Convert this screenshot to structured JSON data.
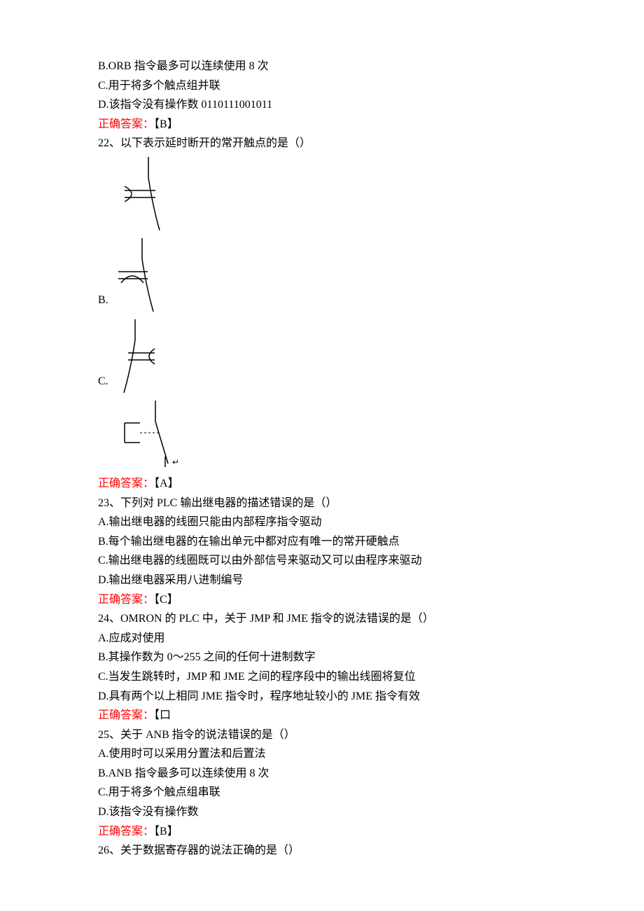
{
  "q21_remainder": {
    "optB": "B.ORB 指令最多可以连续使用 8 次",
    "optC": "C.用于将多个触点组并联",
    "optD": "D.该指令没有操作数 0110111001011",
    "answer_label": "正确答案：",
    "answer_value": "【B】"
  },
  "q22": {
    "stem": "22、以下表示延时断开的常开触点的是（）",
    "optB_label": "B.",
    "optC_label": "C.",
    "answer_label": "正确答案：",
    "answer_value": "【A】"
  },
  "q23": {
    "stem": "23、下列对 PLC 输出继电器的描述错误的是（）",
    "optA": "A.输出继电器的线圈只能由内部程序指令驱动",
    "optB": "B.每个输出继电器的在输出单元中都对应有唯一的常开硬触点",
    "optC": "C.输出继电器的线圈既可以由外部信号来驱动又可以由程序来驱动",
    "optD": "D.输出继电器采用八进制编号",
    "answer_label": "正确答案：",
    "answer_value": "【C】"
  },
  "q24": {
    "stem": "24、OMRON 的 PLC 中，关于 JMP 和 JME 指令的说法错误的是（）",
    "optA": "A.应成对使用",
    "optB": "B.其操作数为 0～255 之间的任何十进制数字",
    "optC": "C.当发生跳转时，JMP 和 JME 之间的程序段中的输出线圈将复位",
    "optD": "D.具有两个以上相同 JME 指令时，程序地址较小的 JME 指令有效",
    "answer_label": "正确答案：",
    "answer_value": "【口"
  },
  "q25": {
    "stem": "25、关于 ANB 指令的说法错误的是（）",
    "optA": "A.使用时可以采用分置法和后置法",
    "optB": "B.ANB 指令最多可以连续使用 8 次",
    "optC": "C.用于将多个触点组串联",
    "optD": "D.该指令没有操作数",
    "answer_label": "正确答案：",
    "answer_value": "【B】"
  },
  "q26": {
    "stem": "26、关于数据寄存器的说法正确的是（）"
  }
}
